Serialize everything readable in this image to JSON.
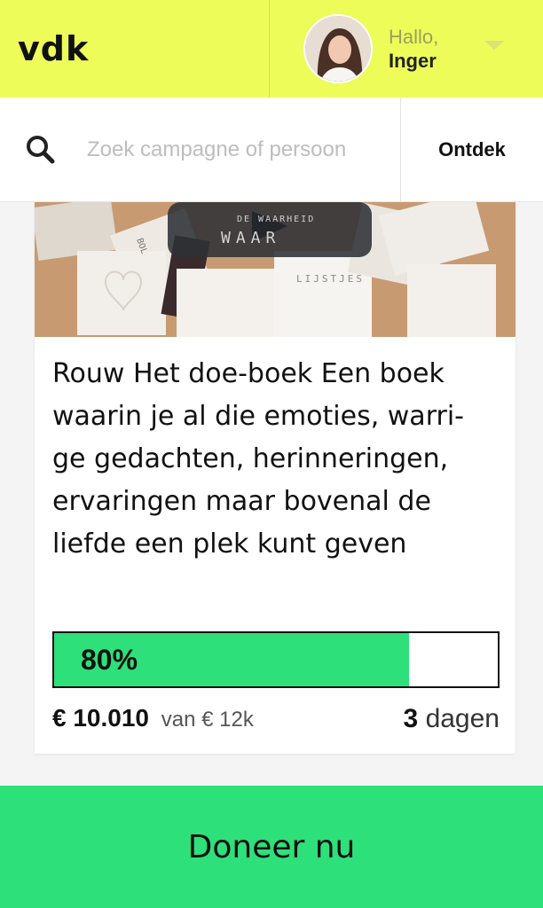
{
  "header": {
    "logo": "vdk",
    "greeting": "Hallo,",
    "username": "Inger",
    "accent_color": "#eefc5a"
  },
  "search": {
    "placeholder": "Zoek campagne of persoon",
    "discover_label": "Ontdek"
  },
  "campaign": {
    "title": "Rouw Het doe-boek Een boek\nwaarin je al die emoties, warri-\nge gedachten, herinneringen,\nervaringen maar bovenal de\nliefde een plek kunt geven",
    "progress_label": "80%",
    "progress_fraction": 0.8,
    "raised": "€ 10.010",
    "goal": "van € 12k",
    "days_number": "3",
    "days_label": "dagen",
    "image_texts": [
      "WAAR",
      "DE WAARHEID",
      "LIJSTJES",
      "BOL"
    ]
  },
  "footer": {
    "donate_label": "Doneer nu",
    "donate_color": "#2ee07a"
  }
}
